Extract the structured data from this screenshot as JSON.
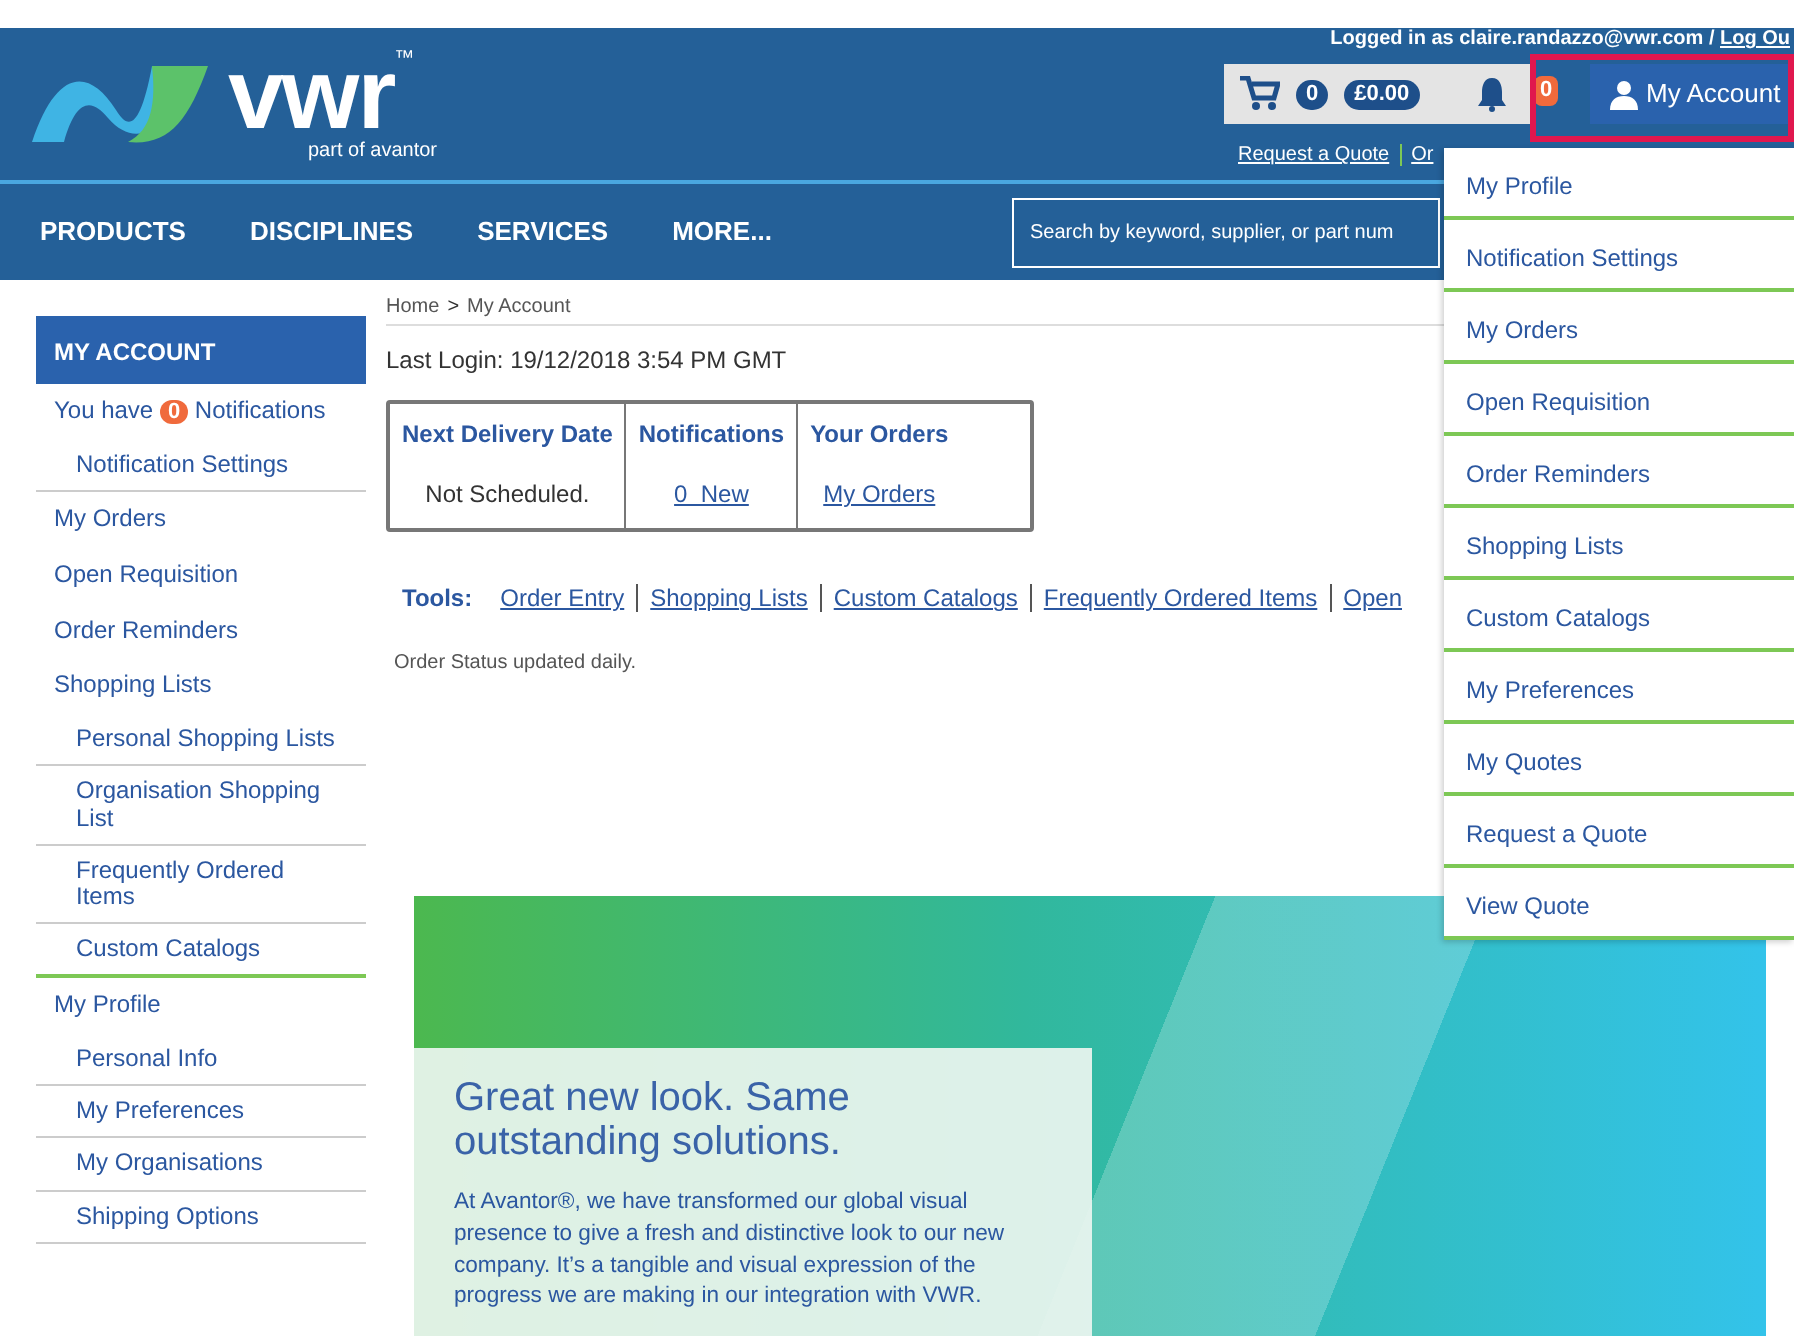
{
  "header": {
    "logo": {
      "wordmark": "vwr",
      "trademark": "™",
      "tagline": "part of avantor"
    },
    "logged_in": "Logged in as claire.randazzo@vwr.com",
    "logged_separator": "/",
    "logout_link": "Log Ou",
    "cart": {
      "count": "0",
      "total": "£0.00"
    },
    "notifications_count": "0",
    "account_button": "My Account",
    "quick_links": [
      "Request a Quote",
      "Or"
    ]
  },
  "nav": {
    "items": [
      "PRODUCTS",
      "DISCIPLINES",
      "SERVICES",
      "MORE..."
    ],
    "search": {
      "placeholder": "Search by keyword, supplier, or part num"
    }
  },
  "sidebar": {
    "title": "MY ACCOUNT",
    "notifications": {
      "prefix": "You have",
      "count": "0",
      "suffix": "Notifications",
      "children": [
        {
          "label": "Notification Settings"
        }
      ]
    },
    "items": [
      {
        "label": "My Orders"
      },
      {
        "label": "Open Requisition"
      },
      {
        "label": "Order Reminders"
      },
      {
        "label": "Shopping Lists",
        "children": [
          {
            "label": "Personal Shopping Lists"
          },
          {
            "label": "Organisation Shopping List"
          },
          {
            "label": "Frequently Ordered Items"
          },
          {
            "label": "Custom Catalogs"
          }
        ]
      },
      {
        "label": "My Profile",
        "children": [
          {
            "label": "Personal Info"
          },
          {
            "label": "My Preferences"
          },
          {
            "label": "My Organisations"
          },
          {
            "label": "Shipping Options"
          }
        ]
      }
    ]
  },
  "breadcrumb": {
    "items": [
      "Home",
      "My Account"
    ],
    "separator": ">"
  },
  "last_login": {
    "label": "Last Login:",
    "value": "19/12/2018 3:54 PM GMT"
  },
  "summary": [
    {
      "heading": "Next Delivery Date",
      "value": "Not Scheduled.",
      "kind": "text"
    },
    {
      "heading": "Notifications",
      "value": "0  New",
      "kind": "link"
    },
    {
      "heading": "Your Orders",
      "value": "My Orders",
      "kind": "link"
    }
  ],
  "tools": {
    "label": "Tools:",
    "links": [
      "Order Entry",
      "Shopping Lists",
      "Custom Catalogs",
      "Frequently Ordered Items",
      "Open"
    ]
  },
  "status_note": "Order Status updated daily.",
  "banner": {
    "heading": "Great new look. Same outstanding solutions.",
    "body": "At Avantor®, we have transformed our global visual presence to give a fresh and distinctive look to our new company. It’s a tangible and visual expression of the progress we are making in our integration with VWR."
  },
  "account_menu": [
    "My Profile",
    "Notification Settings",
    "My Orders",
    "Open Requisition",
    "Order Reminders",
    "Shopping Lists",
    "Custom Catalogs",
    "My Preferences",
    "My Quotes",
    "Request a Quote",
    "View Quote"
  ]
}
